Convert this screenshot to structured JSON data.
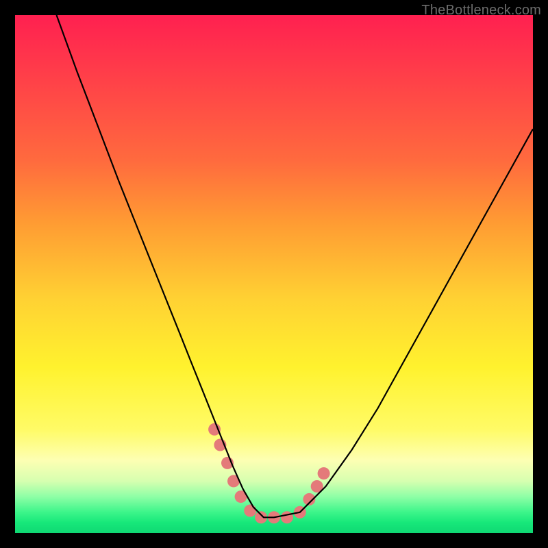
{
  "watermark": "TheBottleneck.com",
  "chart_data": {
    "type": "line",
    "title": "",
    "xlabel": "",
    "ylabel": "",
    "xlim": [
      0,
      100
    ],
    "ylim": [
      0,
      100
    ],
    "grid": false,
    "series": [
      {
        "name": "curve",
        "color": "#000000",
        "x": [
          8,
          12,
          16,
          20,
          24,
          28,
          32,
          34,
          36,
          38,
          40,
          42,
          44,
          46,
          48,
          50,
          55,
          60,
          65,
          70,
          75,
          80,
          85,
          90,
          95,
          100
        ],
        "y": [
          100,
          89,
          78.5,
          68,
          58,
          48,
          38,
          33,
          28,
          23,
          18,
          13,
          8.5,
          5,
          3,
          3,
          4,
          9,
          16,
          24,
          33,
          42,
          51,
          60,
          69,
          78
        ]
      }
    ],
    "markers": {
      "name": "dots",
      "color": "#e47a7a",
      "radius_px": 9,
      "points": [
        {
          "x": 38.5,
          "y": 20
        },
        {
          "x": 39.6,
          "y": 17
        },
        {
          "x": 41.0,
          "y": 13.5
        },
        {
          "x": 42.2,
          "y": 10
        },
        {
          "x": 43.6,
          "y": 7
        },
        {
          "x": 45.4,
          "y": 4.3
        },
        {
          "x": 47.5,
          "y": 3
        },
        {
          "x": 50.0,
          "y": 3
        },
        {
          "x": 52.5,
          "y": 3
        },
        {
          "x": 55.0,
          "y": 4
        },
        {
          "x": 56.8,
          "y": 6.5
        },
        {
          "x": 58.3,
          "y": 9
        },
        {
          "x": 59.6,
          "y": 11.5
        }
      ]
    },
    "background_gradient": [
      {
        "pos": 0.0,
        "color": "#ff2050"
      },
      {
        "pos": 0.5,
        "color": "#ffd233"
      },
      {
        "pos": 0.8,
        "color": "#fffb66"
      },
      {
        "pos": 1.0,
        "color": "#0fd873"
      }
    ]
  }
}
